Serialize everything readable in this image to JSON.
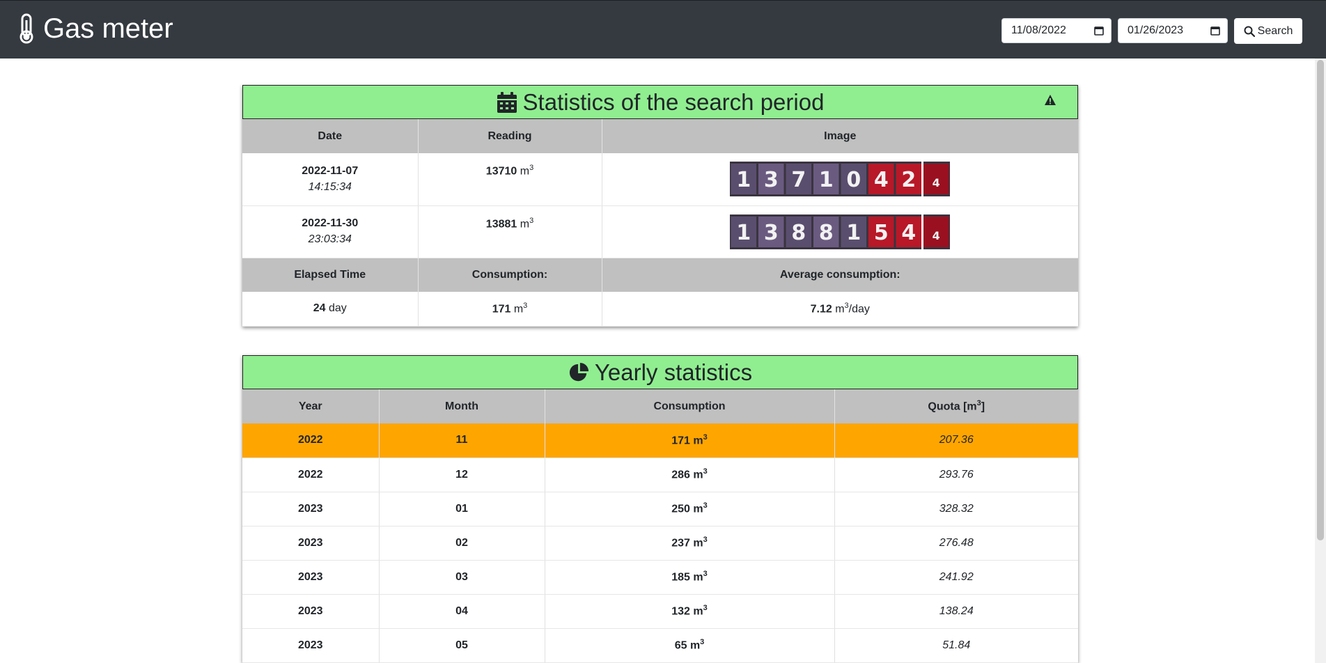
{
  "header": {
    "title": "Gas meter",
    "date_from": "11/08/2022",
    "date_to": "01/26/2023",
    "search_label": "Search"
  },
  "period_card": {
    "title": "Statistics of the search period",
    "columns": [
      "Date",
      "Reading",
      "Image"
    ],
    "readings": [
      {
        "date": "2022-11-07",
        "time": "14:15:34",
        "reading": "13710",
        "unit": "m",
        "digits": [
          "1",
          "3",
          "7",
          "1",
          "0",
          "4",
          "2",
          "4"
        ]
      },
      {
        "date": "2022-11-30",
        "time": "23:03:34",
        "reading": "13881",
        "unit": "m",
        "digits": [
          "1",
          "3",
          "8",
          "8",
          "1",
          "5",
          "4",
          "4"
        ]
      }
    ],
    "summary_columns": [
      "Elapsed Time",
      "Consumption:",
      "Average consumption:"
    ],
    "summary": {
      "elapsed_value": "24",
      "elapsed_unit": "day",
      "consumption_value": "171",
      "consumption_unit": "m",
      "average_value": "7.12",
      "average_unit": "m",
      "average_suffix": "/day"
    }
  },
  "yearly_card": {
    "title": "Yearly statistics",
    "columns": [
      "Year",
      "Month",
      "Consumption",
      "Quota [m"
    ],
    "rows": [
      {
        "year": "2022",
        "month": "11",
        "consumption": "171 m",
        "quota": "207.36",
        "highlight": true
      },
      {
        "year": "2022",
        "month": "12",
        "consumption": "286 m",
        "quota": "293.76",
        "highlight": false
      },
      {
        "year": "2023",
        "month": "01",
        "consumption": "250 m",
        "quota": "328.32",
        "highlight": false
      },
      {
        "year": "2023",
        "month": "02",
        "consumption": "237 m",
        "quota": "276.48",
        "highlight": false
      },
      {
        "year": "2023",
        "month": "03",
        "consumption": "185 m",
        "quota": "241.92",
        "highlight": false
      },
      {
        "year": "2023",
        "month": "04",
        "consumption": "132 m",
        "quota": "138.24",
        "highlight": false
      },
      {
        "year": "2023",
        "month": "05",
        "consumption": "65 m",
        "quota": "51.84",
        "highlight": false
      }
    ]
  },
  "colors": {
    "navbar": "#343a40",
    "card_header": "#90ee90",
    "highlight_row": "#ffa500",
    "table_header": "#c0c0c0"
  },
  "icons": {
    "brand": "thermometer-icon",
    "search": "search-icon",
    "period": "calendar-icon",
    "warning": "warning-icon",
    "yearly": "pie-chart-icon"
  }
}
